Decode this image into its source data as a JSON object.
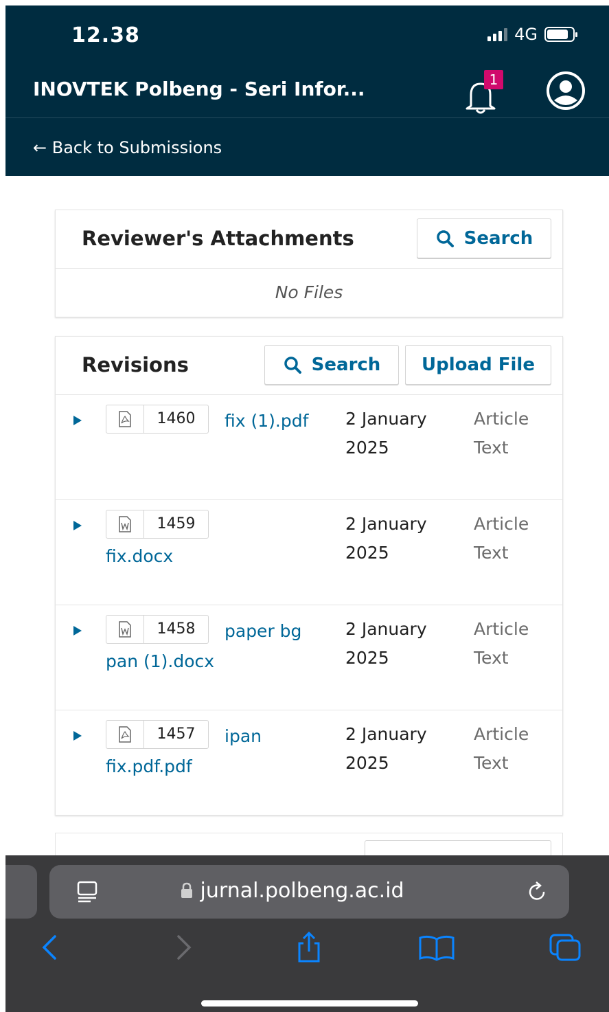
{
  "status_bar": {
    "time": "12.38",
    "network": "4G"
  },
  "header": {
    "site_title": "INOVTEK Polbeng - Seri Infor...",
    "notification_count": "1",
    "back_link": "← Back to Submissions"
  },
  "attachments_panel": {
    "title": "Reviewer's Attachments",
    "search_label": "Search",
    "empty_text": "No Files"
  },
  "revisions_panel": {
    "title": "Revisions",
    "search_label": "Search",
    "upload_label": "Upload File",
    "files": [
      {
        "id": "1460",
        "name": "fix (1).pdf",
        "file_type": "pdf",
        "date": "2 January 2025",
        "genre": "Article Text"
      },
      {
        "id": "1459",
        "name": "fix.docx",
        "file_type": "word",
        "date": "2 January 2025",
        "genre": "Article Text"
      },
      {
        "id": "1458",
        "name": "paper bg pan (1).docx",
        "file_type": "word",
        "date": "2 January 2025",
        "genre": "Article Text"
      },
      {
        "id": "1457",
        "name": "ipan fix.pdf.pdf",
        "file_type": "pdf",
        "date": "2 January 2025",
        "genre": "Article Text"
      }
    ]
  },
  "browser": {
    "url": "jurnal.polbeng.ac.id"
  },
  "colors": {
    "header_bg": "#002c40",
    "link": "#006798",
    "badge": "#d00a6c",
    "safari_bar": "#3a3a3c"
  }
}
